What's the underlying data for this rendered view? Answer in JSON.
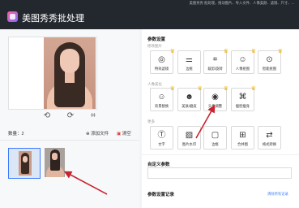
{
  "window": {
    "title": "美图秀秀批处理",
    "top_strip": "美图秀秀 批处理，拖动图片、导入文件、人像美颜、滤镜、尺寸、..."
  },
  "left": {
    "count_label": "数量：2",
    "add_file_label": "添加文件",
    "clear_label": "清空"
  },
  "right": {
    "section_title": "参数设置",
    "group1_label": "修改图片",
    "group2_label": "人像美化",
    "group3_label": "更多",
    "cards": [
      {
        "label": "特效滤镜",
        "icon": "filter-icon"
      },
      {
        "label": "边框",
        "icon": "frame-icon"
      },
      {
        "label": "裁剪/旋转",
        "icon": "crop-icon"
      },
      {
        "label": "人像抠图",
        "icon": "portrait-cutout-icon"
      },
      {
        "label": "智能抠图",
        "icon": "smart-cutout-icon"
      },
      {
        "label": "背景替换",
        "icon": "background-icon"
      },
      {
        "label": "美肤/磨皮",
        "icon": "skin-icon"
      },
      {
        "label": "头像调整",
        "icon": "avatar-adjust-icon"
      },
      {
        "label": "瘦脸瘦身",
        "icon": "slim-icon"
      },
      {
        "label": "文字",
        "icon": "text-icon"
      },
      {
        "label": "图片水印",
        "icon": "image-watermark-icon"
      },
      {
        "label": "边框",
        "icon": "border-icon"
      },
      {
        "label": "合并图",
        "icon": "merge-icon"
      },
      {
        "label": "格式转换",
        "icon": "format-icon"
      }
    ],
    "custom_params_label": "自定义参数",
    "params_record_label": "参数设置记录",
    "link_label": "清除所有记录"
  },
  "colors": {
    "titlebar": "#23272e",
    "accent": "#3a7bff",
    "arrow": "#c8242f",
    "crown": "#f2b51c"
  }
}
